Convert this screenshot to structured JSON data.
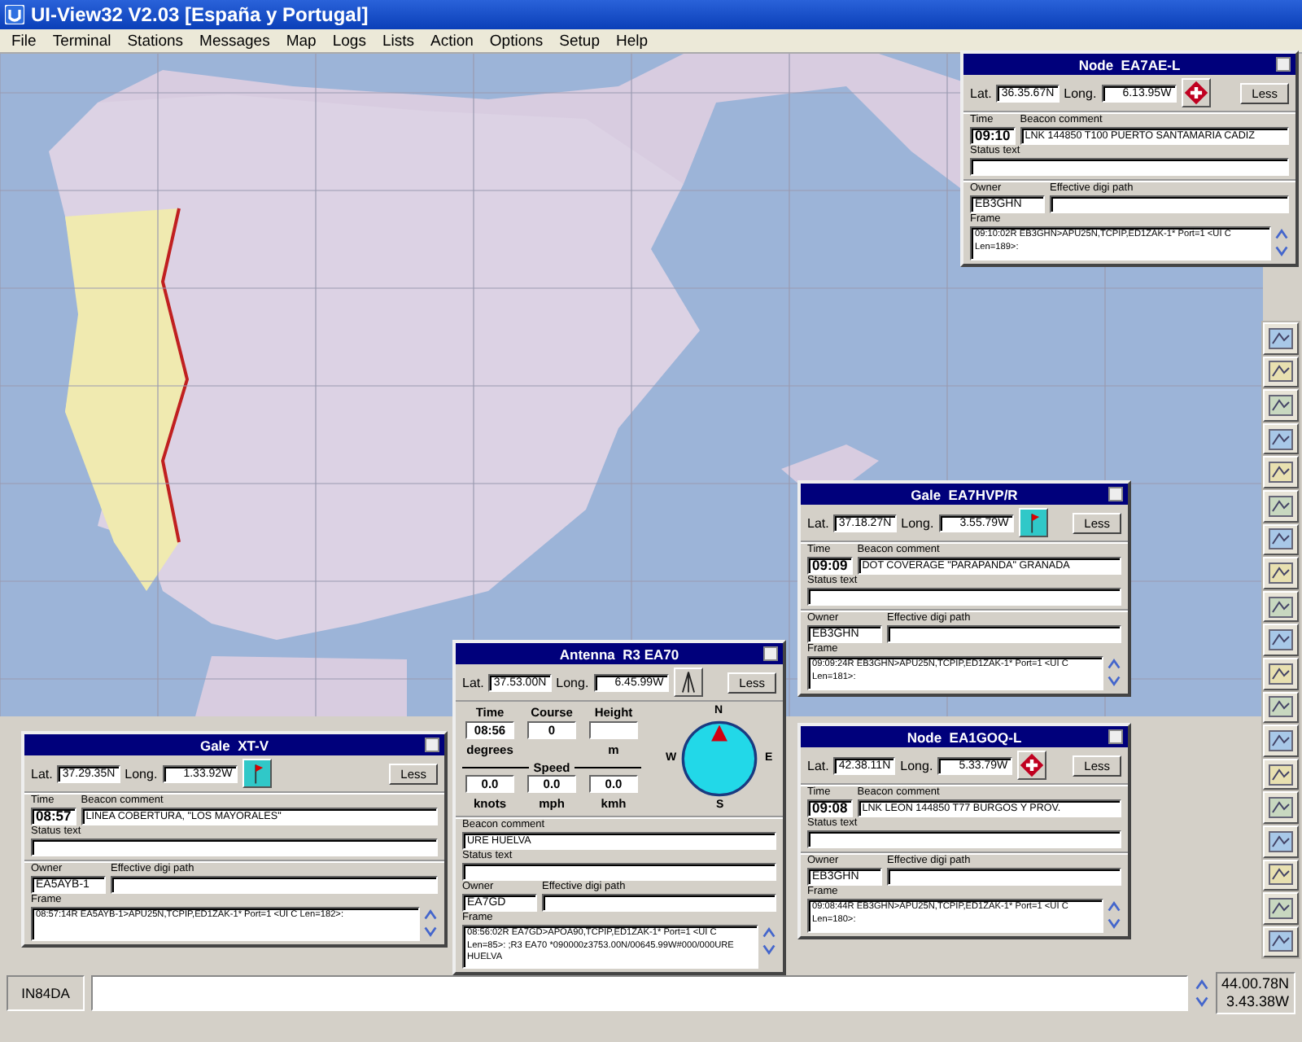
{
  "window": {
    "title": "UI-View32 V2.03 [España y Portugal]"
  },
  "menu": [
    "File",
    "Terminal",
    "Stations",
    "Messages",
    "Map",
    "Logs",
    "Lists",
    "Action",
    "Options",
    "Setup",
    "Help"
  ],
  "windows": [
    {
      "kind": "node",
      "title": "Node  EA7AE-L",
      "lat_label": "Lat.",
      "lat": "36.35.67N",
      "long_label": "Long.",
      "long": "6.13.95W",
      "less": "Less",
      "time_label": "Time",
      "time": "09:10",
      "comment_label": "Beacon comment",
      "comment": "LNK 144850 T100 PUERTO SANTAMARIA CADIZ",
      "status_label": "Status text",
      "owner_label": "Owner",
      "owner": "EB3GHN",
      "digi_label": "Effective digi path",
      "frame_label": "Frame",
      "frame": "09:10:02R EB3GHN>APU25N,TCPIP,ED1ZAK-1* Port=1 <UI C Len=189>:"
    },
    {
      "kind": "gale",
      "title": "Gale  EA7HVP/R",
      "lat_label": "Lat.",
      "lat": "37.18.27N",
      "long_label": "Long.",
      "long": "3.55.79W",
      "less": "Less",
      "time_label": "Time",
      "time": "09:09",
      "comment_label": "Beacon comment",
      "comment": "DOT COVERAGE \"PARAPANDA\" GRANADA",
      "status_label": "Status text",
      "owner_label": "Owner",
      "owner": "EB3GHN",
      "digi_label": "Effective digi path",
      "frame_label": "Frame",
      "frame": "09:09:24R EB3GHN>APU25N,TCPIP,ED1ZAK-1* Port=1 <UI C Len=181>:"
    },
    {
      "kind": "antenna",
      "title": "Antenna  R3 EA70",
      "lat_label": "Lat.",
      "lat": "37.53.00N",
      "long_label": "Long.",
      "long": "6.45.99W",
      "less": "Less",
      "time_label": "Time",
      "time": "08:56",
      "course_label": "Course",
      "course": "0",
      "course_unit": "degrees",
      "height_label": "Height",
      "height_unit": "m",
      "speed_label": "Speed",
      "speeds": [
        {
          "value": "0.0",
          "unit": "knots"
        },
        {
          "value": "0.0",
          "unit": "mph"
        },
        {
          "value": "0.0",
          "unit": "kmh"
        }
      ],
      "compass": [
        "N",
        "E",
        "S",
        "W"
      ],
      "comment_label": "Beacon comment",
      "comment": "URE HUELVA",
      "status_label": "Status text",
      "owner_label": "Owner",
      "owner": "EA7GD",
      "digi_label": "Effective digi path",
      "frame_label": "Frame",
      "frame": "08:56:02R EA7GD>APOA90,TCPIP,ED1ZAK-1* Port=1 <UI C Len=85>: ;R3 EA70  *090000z3753.00N/00645.99W#000/000URE HUELVA"
    },
    {
      "kind": "gale",
      "title": "Gale  XT-V",
      "lat_label": "Lat.",
      "lat": "37.29.35N",
      "long_label": "Long.",
      "long": "1.33.92W",
      "less": "Less",
      "time_label": "Time",
      "time": "08:57",
      "comment_label": "Beacon comment",
      "comment": "LINEA COBERTURA, \"LOS MAYORALES\"",
      "status_label": "Status text",
      "owner_label": "Owner",
      "owner": "EA5AYB-1",
      "digi_label": "Effective digi path",
      "frame_label": "Frame",
      "frame": "08:57:14R EA5AYB-1>APU25N,TCPIP,ED1ZAK-1* Port=1 <UI C Len=182>:"
    },
    {
      "kind": "node",
      "title": "Node  EA1GOQ-L",
      "lat_label": "Lat.",
      "lat": "42.38.11N",
      "long_label": "Long.",
      "long": "5.33.79W",
      "less": "Less",
      "time_label": "Time",
      "time": "09:08",
      "comment_label": "Beacon comment",
      "comment": "LNK LEON 144850 T77 BURGOS Y PROV.",
      "status_label": "Status text",
      "owner_label": "Owner",
      "owner": "EB3GHN",
      "digi_label": "Effective digi path",
      "frame_label": "Frame",
      "frame": "09:08:44R EB3GHN>APU25N,TCPIP,ED1ZAK-1* Port=1 <UI C Len=180>:"
    }
  ],
  "status_bar": {
    "locator": "IN84DA",
    "lat": "44.00.78N",
    "long": "3.43.38W"
  }
}
